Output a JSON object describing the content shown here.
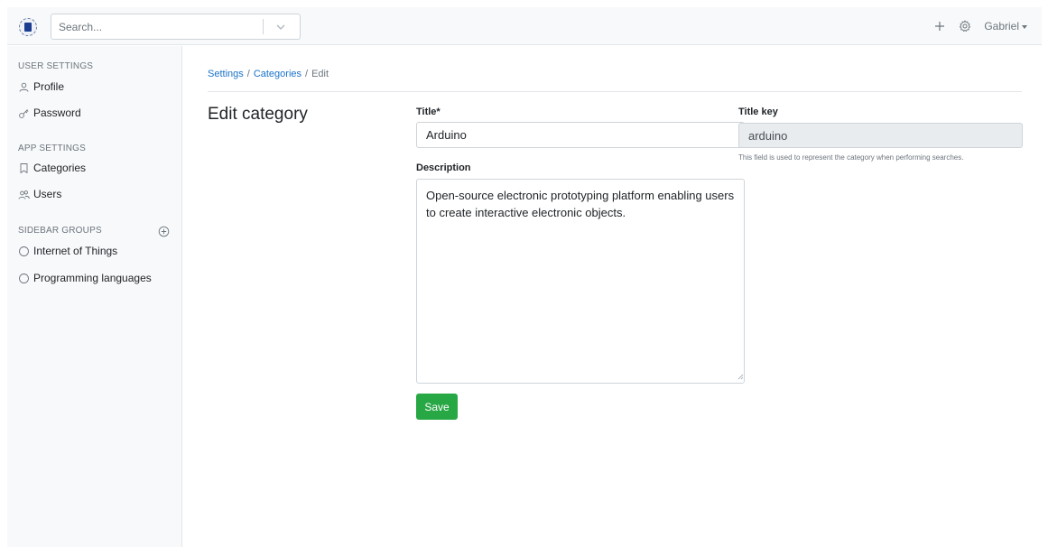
{
  "header": {
    "search_placeholder": "Search...",
    "add_icon": "plus-icon",
    "settings_icon": "gear-icon",
    "user_name": "Gabriel"
  },
  "sidebar": {
    "user_settings_heading": "USER SETTINGS",
    "user_items": [
      {
        "label": "Profile",
        "icon": "user-icon"
      },
      {
        "label": "Password",
        "icon": "key-icon"
      }
    ],
    "app_settings_heading": "APP SETTINGS",
    "app_items": [
      {
        "label": "Categories",
        "icon": "bookmark-icon"
      },
      {
        "label": "Users",
        "icon": "users-icon"
      }
    ],
    "groups_heading": "SIDEBAR GROUPS",
    "groups": [
      {
        "label": "Internet of Things",
        "icon": "circle-icon"
      },
      {
        "label": "Programming languages",
        "icon": "circle-icon"
      }
    ]
  },
  "breadcrumb": {
    "items": [
      "Settings",
      "Categories",
      "Edit"
    ],
    "separator": "/"
  },
  "page_title": "Edit category",
  "form": {
    "title_label": "Title*",
    "title_value": "Arduino",
    "title_key_label": "Title key",
    "title_key_value": "arduino",
    "title_key_help": "This field is used to represent the category when performing searches.",
    "description_label": "Description",
    "description_value": "Open-source electronic prototyping platform enabling users to create interactive electronic objects.",
    "save_label": "Save"
  },
  "colors": {
    "link": "#1a73c9",
    "primary_button": "#28a745",
    "sidebar_bg": "#f8f9fa",
    "readonly_bg": "#e9ecef"
  }
}
